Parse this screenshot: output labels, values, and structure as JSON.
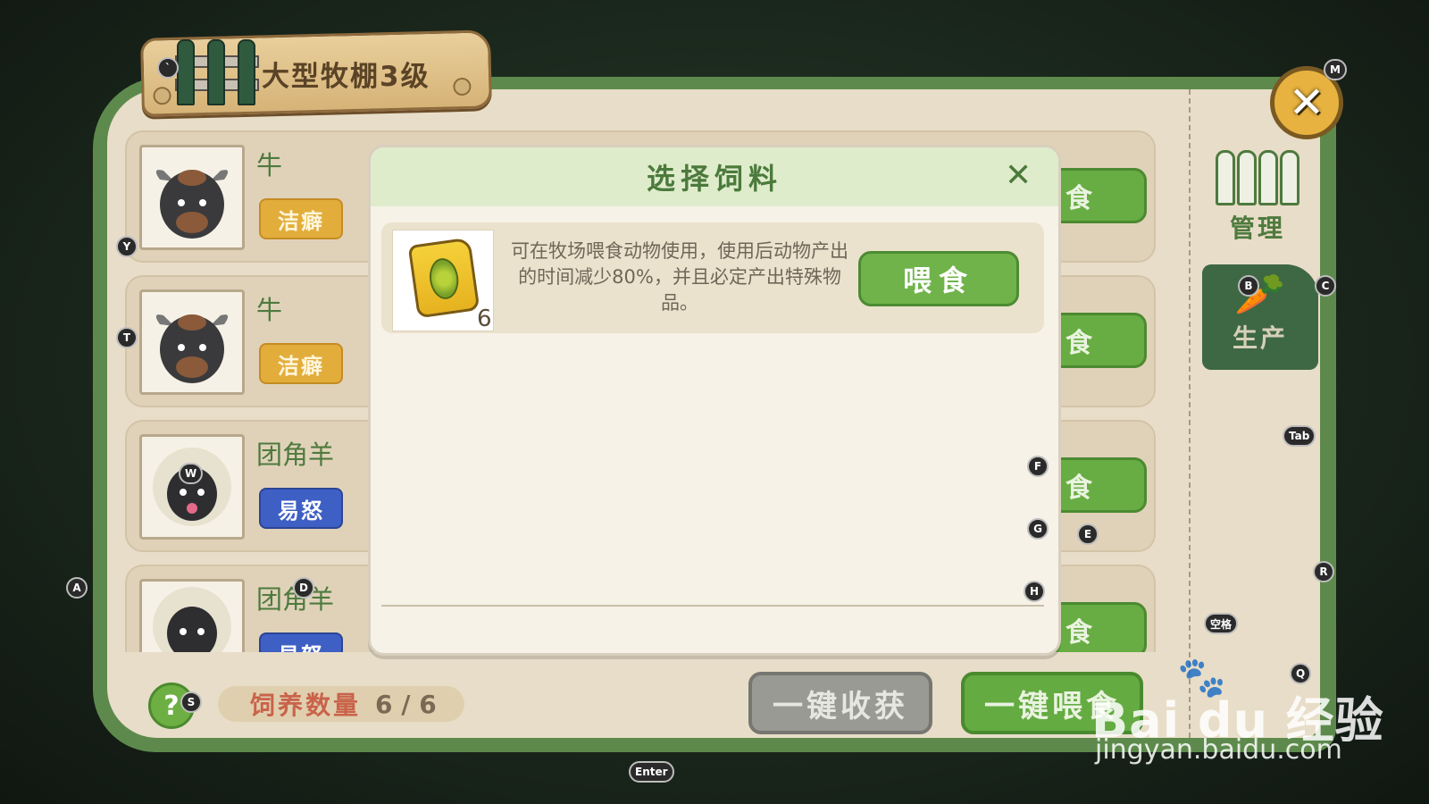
{
  "window": {
    "title": "大型牧棚3级"
  },
  "sidebar": {
    "manage_label": "管理",
    "production_label": "生产"
  },
  "animals": [
    {
      "name": "牛",
      "trait": "洁癖",
      "trait_color": "#e2ad3b",
      "portrait_icon": "cow-icon",
      "feed_label": "食"
    },
    {
      "name": "牛",
      "trait": "洁癖",
      "trait_color": "#e2ad3b",
      "portrait_icon": "cow-icon",
      "feed_label": "食"
    },
    {
      "name": "团角羊",
      "trait": "易怒",
      "trait_color": "#3e5fc4",
      "portrait_icon": "sheep-icon",
      "feed_label": "食"
    },
    {
      "name": "团角羊",
      "trait": "易怒",
      "trait_color": "#3e5fc4",
      "portrait_icon": "sheep-icon",
      "feed_label": "食"
    }
  ],
  "bottom": {
    "help_label": "?",
    "feed_count_label": "饲养数量",
    "feed_count_value": "6 / 6",
    "harvest_all_label": "一键收获",
    "feed_all_label": "一键喂食"
  },
  "modal": {
    "title": "选择饲料",
    "close_icon": "close-icon",
    "item": {
      "icon": "corn-feed-bag-icon",
      "count": "6",
      "description": "可在牧场喂食动物使用，使用后动物产出的时间减少80%，并且必定产出特殊物品。",
      "action_label": "喂食"
    }
  },
  "key_hints": {
    "backtick": "`",
    "m": "M",
    "y": "Y",
    "t": "T",
    "w": "W",
    "a": "A",
    "d": "D",
    "s": "S",
    "b": "B",
    "c": "C",
    "tab": "Tab",
    "f": "F",
    "g": "G",
    "e": "E",
    "h": "H",
    "r": "R",
    "space": "空格",
    "q": "Q",
    "enter": "Enter"
  },
  "watermark": {
    "logo": "Bai du 经验",
    "url": "jingyan.baidu.com"
  },
  "colors": {
    "board_green": "#5d8a4c",
    "panel_beige": "#e8ddc8",
    "accent_green": "#6fb34a",
    "header_green": "#dfeccb",
    "close_gold": "#e7b23f"
  }
}
